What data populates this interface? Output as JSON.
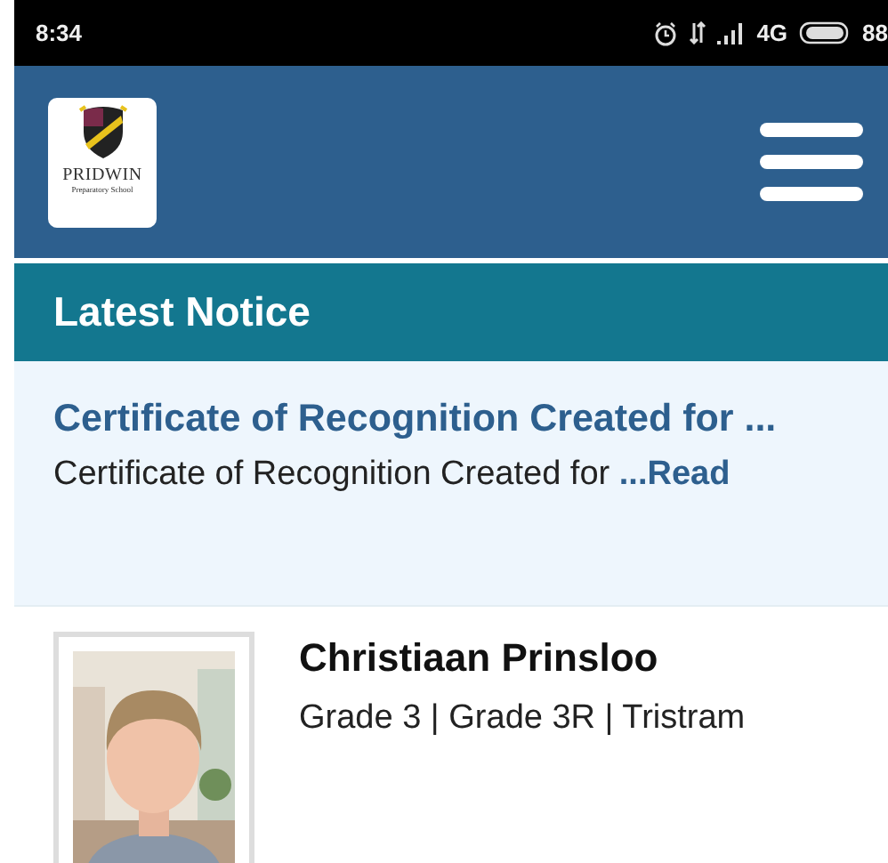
{
  "status_bar": {
    "time": "8:34",
    "network": "4G",
    "battery": "88"
  },
  "header": {
    "logo": {
      "name": "PRIDWIN",
      "subtitle": "Preparatory School"
    }
  },
  "section": {
    "title": "Latest Notice"
  },
  "notice": {
    "title": "Certificate of Recognition Created for ...",
    "excerpt": "Certificate of Recognition Created for",
    "link": "...Read"
  },
  "student": {
    "name": "Christiaan Prinsloo",
    "details": "Grade 3 | Grade 3R | Tristram"
  }
}
